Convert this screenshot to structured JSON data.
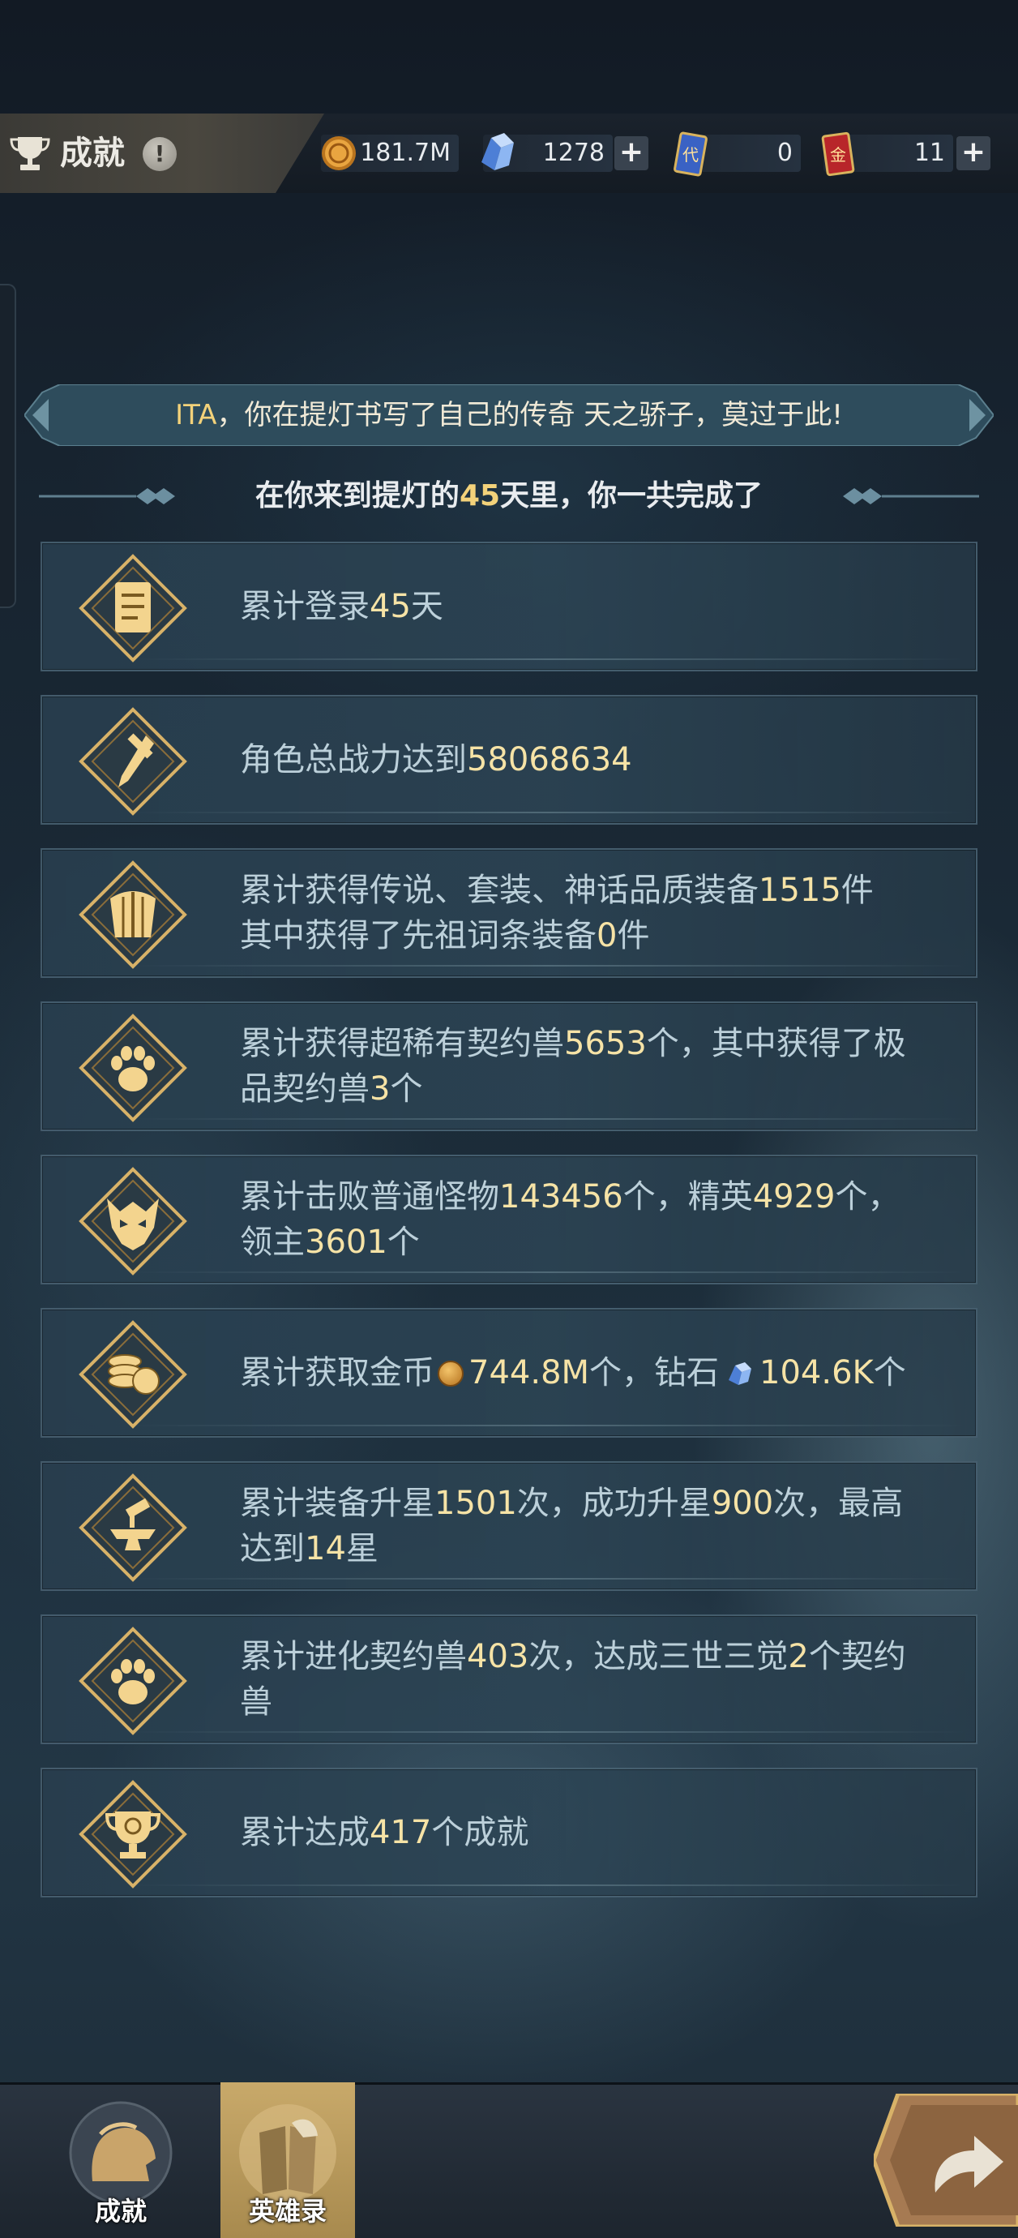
{
  "header": {
    "title": "成就",
    "info_glyph": "!",
    "resources": {
      "gold": "181.7M",
      "diamond": "1278",
      "ticket_blue": "0",
      "ticket_red": "11"
    },
    "plus_glyph": "+"
  },
  "banner": {
    "name": "ITA",
    "text": "，你在提灯书写了自己的传奇 天之骄子，莫过于此!"
  },
  "subtitle": {
    "prefix": "在你来到提灯的",
    "days": "45",
    "suffix": "天里，你一共完成了"
  },
  "stats": {
    "login": {
      "pre": "累计登录",
      "days": "45",
      "post": "天"
    },
    "power": {
      "pre": "角色总战力达到",
      "value": "58068634"
    },
    "equipment": {
      "pre": "累计获得传说、套装、神话品质装备",
      "count": "1515",
      "mid": "件",
      "line2_pre": "其中获得了先祖词条装备",
      "ancestor": "0",
      "line2_post": "件"
    },
    "beast": {
      "pre": "累计获得超稀有契约兽",
      "count": "5653",
      "mid": "个，其中获得了极",
      "line2_pre": "品契约兽",
      "top": "3",
      "line2_post": "个"
    },
    "monsters": {
      "pre": "累计击败普通怪物",
      "normal": "143456",
      "mid1": "个，精英",
      "elite": "4929",
      "mid2": "个，",
      "line2_pre": "领主",
      "boss": "3601",
      "line2_post": "个"
    },
    "income": {
      "pre": "累计获取金币",
      "gold": "744.8M",
      "mid": "个，钻石",
      "diamond": "104.6K",
      "post": "个"
    },
    "star": {
      "pre": "累计装备升星",
      "attempts": "1501",
      "mid1": "次，成功升星",
      "success": "900",
      "mid2": "次，最高",
      "line2_pre": "达到",
      "max": "14",
      "line2_post": "星"
    },
    "evolve": {
      "pre": "累计进化契约兽",
      "count": "403",
      "mid": "次，达成三世三觉",
      "awake": "2",
      "post": "个契约",
      "line2": "兽"
    },
    "achievements": {
      "pre": "累计达成",
      "count": "417",
      "post": "个成就"
    }
  },
  "tabs": {
    "achievement": "成就",
    "heroes": "英雄录"
  },
  "colors": {
    "gold_text": "#f3d27a",
    "row_bg": "#2c4454",
    "tab_active": "#c8a96a"
  },
  "icons": [
    "trophy-icon",
    "gold-coin-icon",
    "diamond-icon",
    "ticket-blue-icon",
    "ticket-red-icon",
    "scroll-icon",
    "sword-icon",
    "armor-icon",
    "paw-icon",
    "demon-icon",
    "coins-icon",
    "anvil-icon",
    "trophy-emblem-icon",
    "back-arrow-icon"
  ]
}
